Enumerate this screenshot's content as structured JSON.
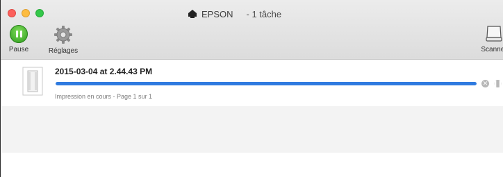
{
  "window": {
    "title": "EPSON",
    "task_count": "- 1 tâche"
  },
  "toolbar": {
    "pause_label": "Pause",
    "settings_label": "Réglages",
    "scanner_label": "Scanner"
  },
  "jobs": [
    {
      "name": "2015-03-04 at 2.44.43 PM",
      "status": "Impression en cours - Page 1 sur 1",
      "progress_fraction": 1.0
    }
  ],
  "colors": {
    "progress": "#2f7be0",
    "pause_green": "#34c84a"
  }
}
